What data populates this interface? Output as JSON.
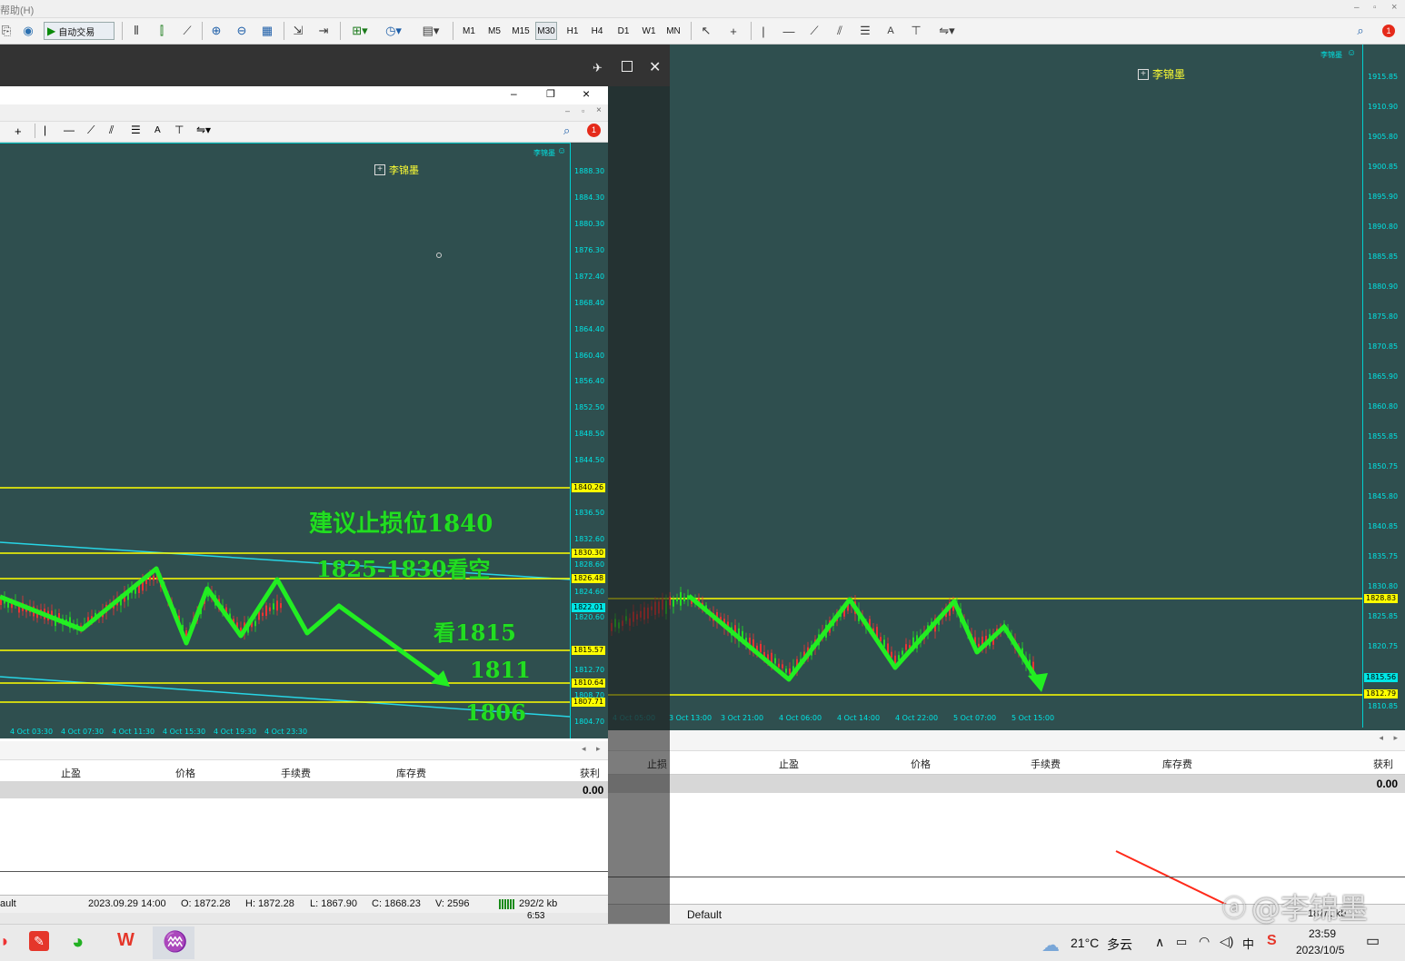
{
  "menubar": {
    "help_menu": "帮助(H)"
  },
  "toolbar": {
    "auto_trade_label": "自动交易",
    "timeframes": [
      "M1",
      "M5",
      "M15",
      "M30",
      "H1",
      "H4",
      "D1",
      "W1",
      "MN"
    ],
    "text_tool": "A"
  },
  "right_chart": {
    "indicator_name": "李锦墨",
    "corner_label": "李锦墨",
    "price_ticks": [
      "1915.85",
      "1910.90",
      "1905.80",
      "1900.85",
      "1895.90",
      "1890.80",
      "1885.85",
      "1880.90",
      "1875.80",
      "1870.85",
      "1865.90",
      "1860.80",
      "1855.85",
      "1850.75",
      "1845.80",
      "1840.85",
      "1835.75",
      "1830.80",
      "1825.85",
      "1820.75",
      "1815.80",
      "1810.85"
    ],
    "price_tags": [
      "1828.83",
      "1815.56",
      "1812.79"
    ],
    "time_ticks": [
      "4 Oct 05:00",
      "3 Oct 13:00",
      "3 Oct 21:00",
      "4 Oct 06:00",
      "4 Oct 14:00",
      "4 Oct 22:00",
      "5 Oct 07:00",
      "5 Oct 15:00"
    ],
    "columns": [
      "止损",
      "止盈",
      "价格",
      "手续费",
      "库存费",
      "获利"
    ],
    "profit_total": "0.00",
    "status_profile": "Default",
    "status_traffic": "187/1 kb"
  },
  "left_window": {
    "indicator_name": "李锦墨",
    "corner_label": "李锦墨",
    "price_ticks": [
      "1888.30",
      "1884.30",
      "1880.30",
      "1876.30",
      "1872.40",
      "1868.40",
      "1864.40",
      "1860.40",
      "1856.40",
      "1852.50",
      "1848.50",
      "1844.50",
      "1840.26",
      "1836.50",
      "1832.60",
      "1830.30",
      "1828.60",
      "1826.48",
      "1824.60",
      "1822.01",
      "1820.60",
      "1815.57",
      "1812.70",
      "1810.64",
      "1808.70",
      "1807.71",
      "1804.70"
    ],
    "price_tags": [
      "1840.26",
      "1830.30",
      "1826.48",
      "1822.01",
      "1815.57",
      "1810.64",
      "1807.71"
    ],
    "cyan_tag": "1822.01",
    "time_ticks": [
      "4 Oct 03:30",
      "4 Oct 07:30",
      "4 Oct 11:30",
      "4 Oct 15:30",
      "4 Oct 19:30",
      "4 Oct 23:30"
    ],
    "annotations": {
      "stop_loss": "建议止损位1840",
      "short_zone": "1825-1830看空",
      "target1": "看1815",
      "target2": "1811",
      "target3": "1806"
    },
    "columns": [
      "止盈",
      "价格",
      "手续费",
      "库存费",
      "获利"
    ],
    "profit_total": "0.00",
    "status": {
      "profile": "ault",
      "time": "2023.09.29 14:00",
      "open": "O: 1872.28",
      "high": "H: 1872.28",
      "low": "L: 1867.90",
      "close": "C: 1868.23",
      "volume": "V: 2596",
      "traffic": "292/2 kb"
    },
    "clock": "6:53"
  },
  "taskbar": {
    "weather_temp": "21°C",
    "weather_desc": "多云",
    "ime": "中",
    "time": "23:59",
    "date": "2023/10/5",
    "watermark": "@李锦墨"
  },
  "colors": {
    "chart_bg": "#2f4f4f",
    "level_line": "#ffff00",
    "arrow_green": "#22ee22",
    "axis_text": "#00e4e4",
    "arrow_red": "#ff2a1a"
  }
}
